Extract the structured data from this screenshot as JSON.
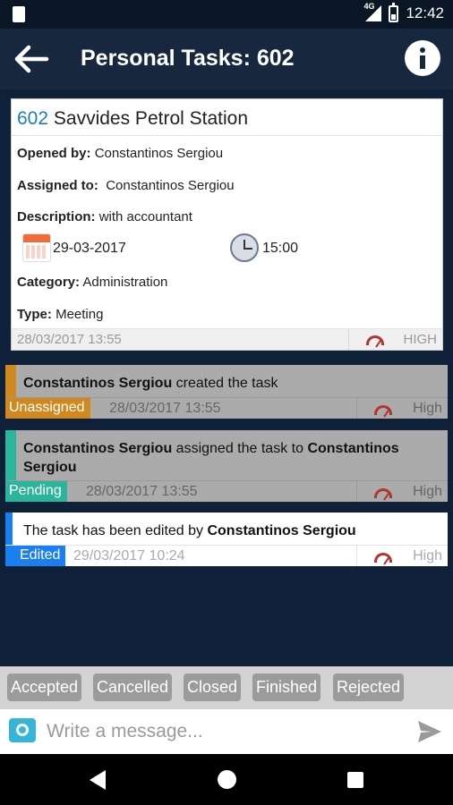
{
  "status_bar": {
    "time": "12:42",
    "network": "4G"
  },
  "header": {
    "title": "Personal Tasks: 602"
  },
  "task": {
    "number": "602",
    "name": "Savvides Petrol Station",
    "opened_by_label": "Opened by:",
    "opened_by": "Constantinos Sergiou",
    "assigned_to_label": "Assigned to:",
    "assigned_to": "Constantinos Sergiou",
    "description_label": "Description:",
    "description": "with accountant",
    "date": "29-03-2017",
    "time": "15:00",
    "category_label": "Category:",
    "category": "Administration",
    "type_label": "Type:",
    "type": "Meeting",
    "created": "28/03/2017 13:55",
    "priority": "HIGH"
  },
  "activity": [
    {
      "actor": "Constantinos Sergiou",
      "action": " created the task",
      "status": "Unassigned",
      "status_color": "#d0891f",
      "timestamp": "28/03/2017 13:55",
      "priority": "High"
    },
    {
      "actor": "Constantinos Sergiou",
      "action": " assigned the task to ",
      "target": "Constantinos Sergiou",
      "status": "Pending",
      "status_color": "#2bb59a",
      "timestamp": "28/03/2017 13:55",
      "priority": "High"
    },
    {
      "prefix": "The task has been edited by ",
      "actor": "Constantinos Sergiou",
      "status": "Edited",
      "status_color": "#1a7ff0",
      "timestamp": "29/03/2017 10:24",
      "priority": "High"
    }
  ],
  "actions": [
    "Accepted",
    "Cancelled",
    "Closed",
    "Finished",
    "Rejected"
  ],
  "composer": {
    "placeholder": "Write a message..."
  },
  "icons": {
    "back": "arrow-left-icon",
    "info": "info-icon",
    "calendar": "calendar-icon",
    "clock": "clock-icon",
    "priority": "gauge-icon",
    "camera": "camera-icon",
    "send": "send-icon"
  }
}
